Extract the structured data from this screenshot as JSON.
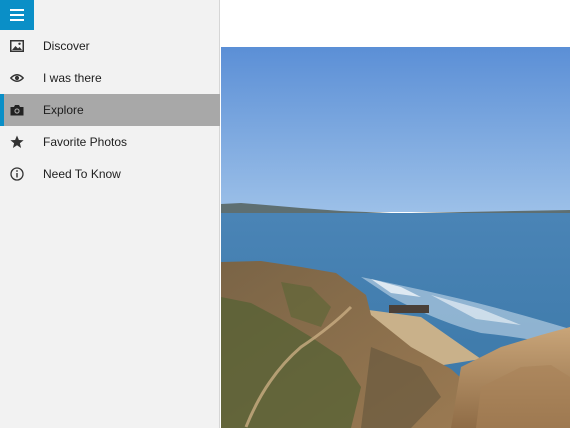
{
  "nav": {
    "items": [
      {
        "label": "Discover",
        "icon": "image-icon",
        "active": false
      },
      {
        "label": "I was there",
        "icon": "eye-icon",
        "active": false
      },
      {
        "label": "Explore",
        "icon": "camera-icon",
        "active": true
      },
      {
        "label": "Favorite Photos",
        "icon": "star-icon",
        "active": false
      },
      {
        "label": "Need To Know",
        "icon": "info-icon",
        "active": false
      }
    ]
  },
  "colors": {
    "accent": "#0a8fc7",
    "active_bg": "#a8a8a8",
    "sidebar_bg": "#f2f2f2"
  }
}
